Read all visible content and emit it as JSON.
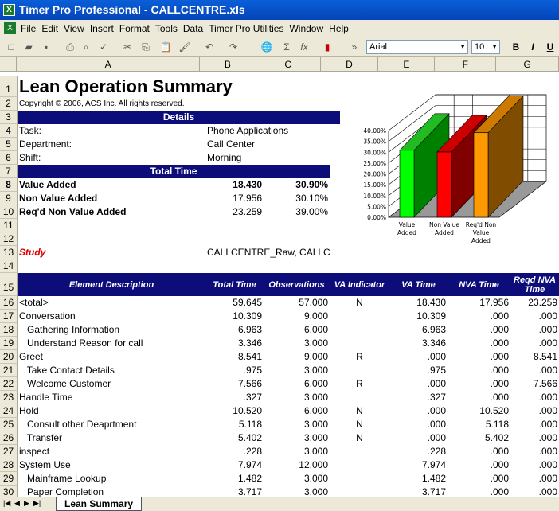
{
  "window": {
    "title": "Timer Pro Professional - CALLCENTRE.xls"
  },
  "menu": [
    "File",
    "Edit",
    "View",
    "Insert",
    "Format",
    "Tools",
    "Data",
    "Timer Pro Utilities",
    "Window",
    "Help"
  ],
  "toolbar": {
    "font": "Arial",
    "size": "10",
    "bold": "B",
    "italic": "I",
    "underline": "U"
  },
  "columns": [
    "A",
    "B",
    "C",
    "D",
    "E",
    "F",
    "G"
  ],
  "summary": {
    "title": "Lean Operation Summary",
    "copyright": "Copyright © 2006, ACS Inc.  All rights reserved.",
    "details_header": "Details",
    "task_label": "Task:",
    "task": "Phone Applications",
    "dept_label": "Department:",
    "dept": "Call Center",
    "shift_label": "Shift:",
    "shift": "Morning",
    "total_time_header": "Total Time",
    "va_label": "Value Added",
    "va_time": "18.430",
    "va_pct": "30.90%",
    "nva_label": "Non Value Added",
    "nva_time": "17.956",
    "nva_pct": "30.10%",
    "rnva_label": "Req'd Non Value Added",
    "rnva_time": "23.259",
    "rnva_pct": "39.00%",
    "study_label": "Study",
    "study": "CALLCENTRE_Raw, CALLC"
  },
  "chart_data": {
    "type": "bar",
    "three_d": true,
    "categories": [
      "Value Added",
      "Non Value Added",
      "Req'd Non Value Added"
    ],
    "values": [
      30.9,
      30.1,
      39.0
    ],
    "colors": [
      "#00ff00",
      "#ff0000",
      "#ff9900"
    ],
    "ylim": [
      0,
      40
    ],
    "yticks": [
      "0.00%",
      "5.00%",
      "10.00%",
      "15.00%",
      "20.00%",
      "25.00%",
      "30.00%",
      "35.00%",
      "40.00%"
    ],
    "grid": true
  },
  "table": {
    "headers": [
      "Element Description",
      "Total Time",
      "Observations",
      "VA Indicator",
      "VA Time",
      "NVA Time",
      "Reqd NVA Time"
    ],
    "rows": [
      [
        "<total>",
        "59.645",
        "57.000",
        "N",
        "18.430",
        "17.956",
        "23.259"
      ],
      [
        "Conversation",
        "10.309",
        "9.000",
        "",
        "10.309",
        ".000",
        ".000"
      ],
      [
        "   Gathering Information",
        "6.963",
        "6.000",
        "",
        "6.963",
        ".000",
        ".000"
      ],
      [
        "   Understand Reason for call",
        "3.346",
        "3.000",
        "",
        "3.346",
        ".000",
        ".000"
      ],
      [
        "Greet",
        "8.541",
        "9.000",
        "R",
        ".000",
        ".000",
        "8.541"
      ],
      [
        "   Take Contact Details",
        ".975",
        "3.000",
        "",
        ".975",
        ".000",
        ".000"
      ],
      [
        "   Welcome Customer",
        "7.566",
        "6.000",
        "R",
        ".000",
        ".000",
        "7.566"
      ],
      [
        "Handle Time",
        ".327",
        "3.000",
        "",
        ".327",
        ".000",
        ".000"
      ],
      [
        "Hold",
        "10.520",
        "6.000",
        "N",
        ".000",
        "10.520",
        ".000"
      ],
      [
        "   Consult other Deaprtment",
        "5.118",
        "3.000",
        "N",
        ".000",
        "5.118",
        ".000"
      ],
      [
        "   Transfer",
        "5.402",
        "3.000",
        "N",
        ".000",
        "5.402",
        ".000"
      ],
      [
        "inspect",
        ".228",
        "3.000",
        "",
        ".228",
        ".000",
        ".000"
      ],
      [
        "System Use",
        "7.974",
        "12.000",
        "",
        "7.974",
        ".000",
        ".000"
      ],
      [
        "   Mainframe Lookup",
        "1.482",
        "3.000",
        "",
        "1.482",
        ".000",
        ".000"
      ],
      [
        "   Paper Completion",
        "3.717",
        "3.000",
        "",
        "3.717",
        ".000",
        ".000"
      ]
    ]
  },
  "sheet_tabs": [
    "Lean Summary"
  ]
}
